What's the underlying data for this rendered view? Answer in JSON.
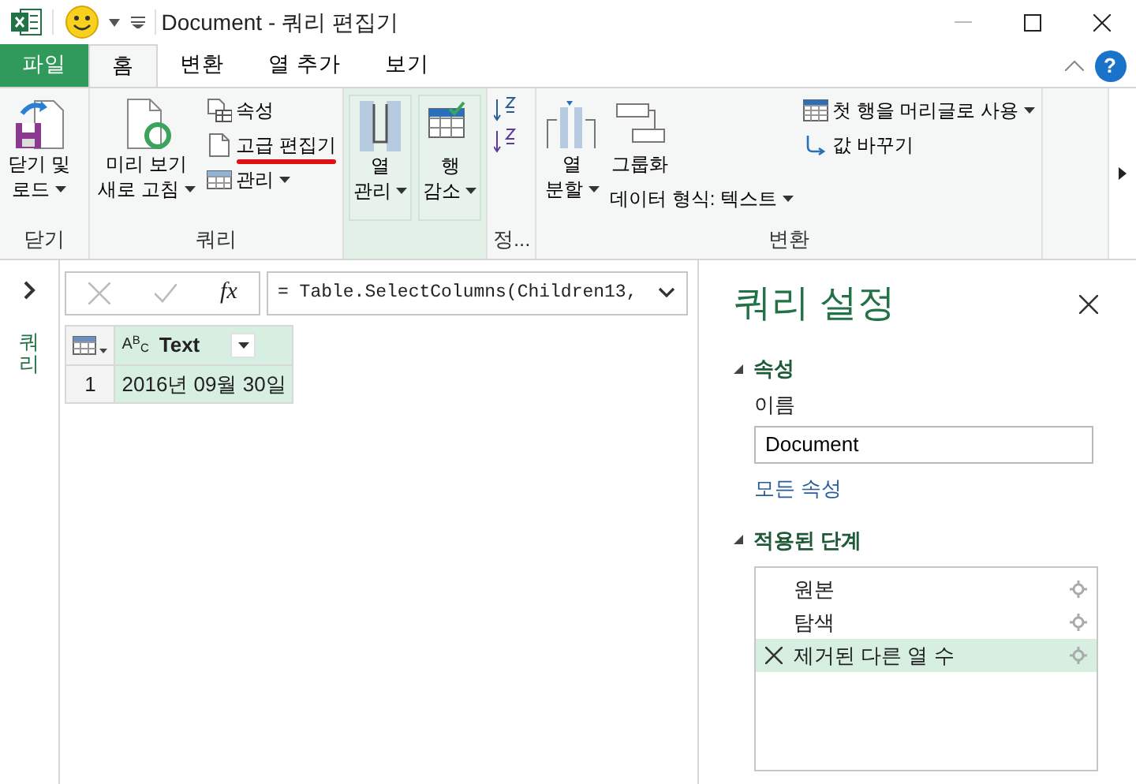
{
  "window": {
    "title": "Document - 쿼리 편집기"
  },
  "ribbon_tabs": [
    {
      "label": "파일",
      "kind": "file",
      "selected": false
    },
    {
      "label": "홈",
      "kind": "tab",
      "selected": true
    },
    {
      "label": "변환",
      "kind": "tab",
      "selected": false
    },
    {
      "label": "열 추가",
      "kind": "tab",
      "selected": false
    },
    {
      "label": "보기",
      "kind": "tab",
      "selected": false
    }
  ],
  "help": "?",
  "ribbon_groups": [
    {
      "label": "닫기",
      "shaded": false,
      "columns": [
        [
          {
            "kind": "large",
            "lines": [
              "닫기 및",
              "로드"
            ],
            "dropdown": true,
            "underlined": false
          }
        ]
      ]
    },
    {
      "label": "쿼리",
      "shaded": false,
      "columns": [
        [
          {
            "kind": "large",
            "lines": [
              "미리 보기",
              "새로 고침"
            ],
            "dropdown": true,
            "underlined": false
          }
        ],
        [
          {
            "kind": "small",
            "lines": [
              "속성"
            ],
            "dropdown": false,
            "underlined": false
          },
          {
            "kind": "small",
            "lines": [
              "고급 편집기"
            ],
            "dropdown": false,
            "underlined": true
          },
          {
            "kind": "small",
            "lines": [
              "관리"
            ],
            "dropdown": true,
            "underlined": false
          }
        ]
      ]
    },
    {
      "shaded": true,
      "columns": [
        [
          {
            "kind": "large",
            "lines": [
              "열",
              "관리"
            ],
            "dropdown": true,
            "underlined": false
          }
        ],
        [
          {
            "kind": "large",
            "lines": [
              "행",
              "감소"
            ],
            "dropdown": true,
            "underlined": false
          }
        ]
      ]
    },
    {
      "label": "정...",
      "shaded": false,
      "columns": [
        [
          {
            "kind": "icon",
            "dropdown": false,
            "underlined": false
          },
          {
            "kind": "icon",
            "dropdown": false,
            "underlined": false
          }
        ]
      ]
    },
    {
      "label": "변환",
      "shaded": false,
      "columns": [
        [
          {
            "kind": "large",
            "lines": [
              "열",
              "분할"
            ],
            "dropdown": true,
            "underlined": false
          }
        ],
        [
          {
            "kind": "large",
            "lines": [
              "그룹화"
            ],
            "dropdown": false,
            "underlined": false
          },
          {
            "kind": "small",
            "lines": [
              "데이터 형식: 텍스트"
            ],
            "dropdown": true,
            "underlined": false
          }
        ],
        [
          {
            "kind": "small",
            "lines": [
              "첫 행을 머리글로 사용"
            ],
            "dropdown": true,
            "underlined": false
          },
          {
            "kind": "small",
            "lines": [
              "값 바꾸기"
            ],
            "dropdown": false,
            "underlined": false
          }
        ]
      ]
    }
  ],
  "queries_pane": {
    "label": "쿼리",
    "expanded": false
  },
  "formula_bar": {
    "fx": "fx",
    "formula": "= Table.SelectColumns(Children13,"
  },
  "table": {
    "columns": [
      {
        "type": "A$^{B}$$_{C}$",
        "label": "Text",
        "selected": true
      }
    ],
    "rows": [
      {
        "number": "1",
        "cells": [
          "2016년 09월 30일"
        ]
      }
    ]
  },
  "settings": {
    "title": "쿼리 설정",
    "properties": {
      "heading": "속성",
      "expanded": true,
      "name_label": "이름",
      "name_value": "Document",
      "all_properties": "모든 속성"
    },
    "steps_heading": "적용된 단계",
    "steps_expanded": true,
    "steps": [
      {
        "label": "원본",
        "selected": false
      },
      {
        "label": "탐색",
        "selected": false
      },
      {
        "label": "제거된 다른 열 수",
        "selected": true
      }
    ]
  }
}
